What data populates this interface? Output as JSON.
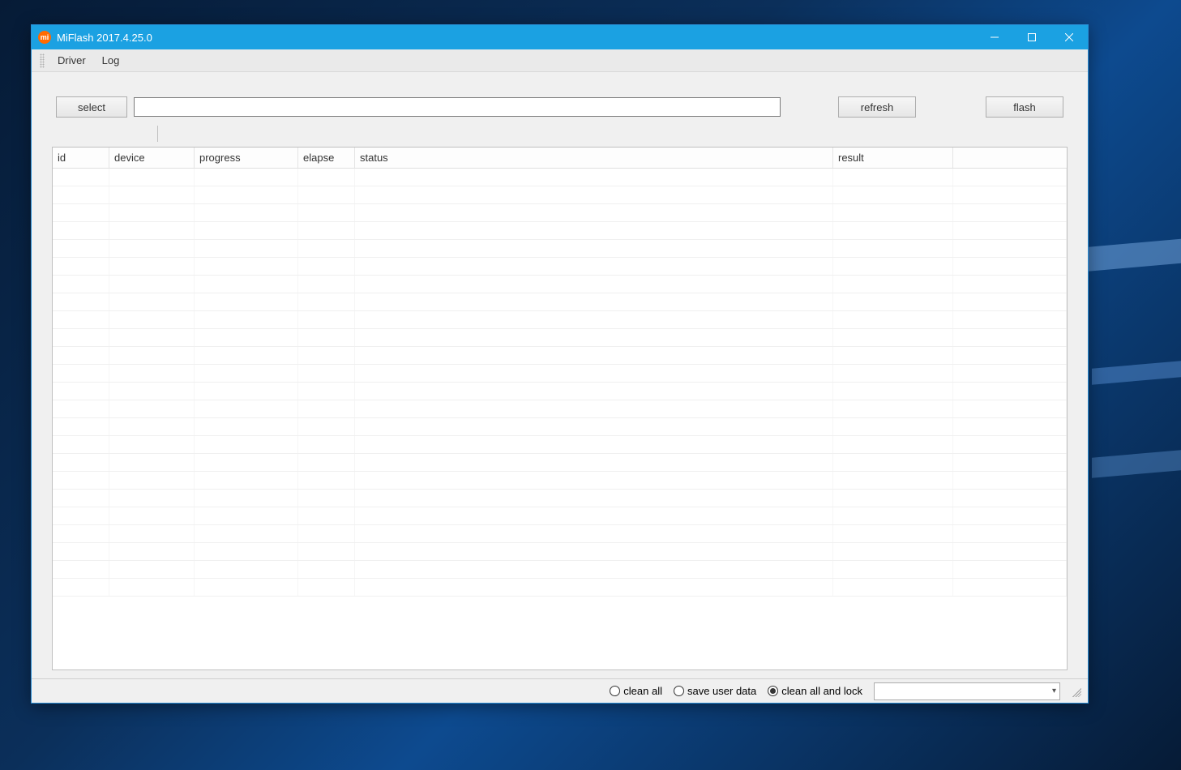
{
  "window": {
    "title": "MiFlash 2017.4.25.0",
    "app_icon_text": "mi"
  },
  "menubar": {
    "items": [
      "Driver",
      "Log"
    ]
  },
  "toolbar": {
    "select_label": "select",
    "path_value": "",
    "refresh_label": "refresh",
    "flash_label": "flash"
  },
  "table": {
    "columns": [
      "id",
      "device",
      "progress",
      "elapse",
      "status",
      "result"
    ],
    "row_count_empty": 24
  },
  "statusbar": {
    "options": [
      {
        "label": "clean all",
        "checked": false
      },
      {
        "label": "save user data",
        "checked": false
      },
      {
        "label": "clean all and lock",
        "checked": true
      }
    ],
    "combo_selected": ""
  }
}
